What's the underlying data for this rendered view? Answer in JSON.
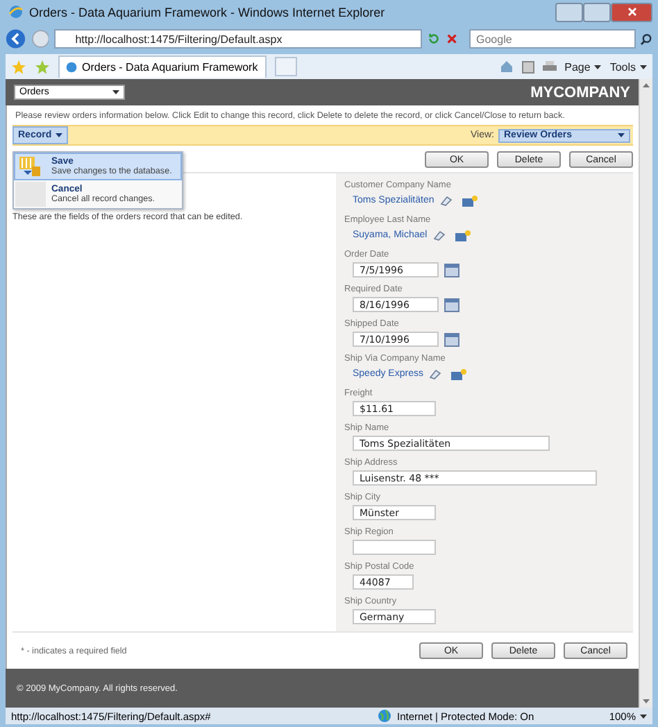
{
  "window": {
    "title": "Orders - Data Aquarium Framework - Windows Internet Explorer"
  },
  "address_bar": {
    "url": "http://localhost:1475/Filtering/Default.aspx"
  },
  "search": {
    "placeholder": "Google"
  },
  "tab": {
    "label": "Orders - Data Aquarium Framework"
  },
  "command_bar": {
    "page": "Page",
    "tools": "Tools"
  },
  "header": {
    "page_select": "Orders",
    "brand": "MYCOMPANY"
  },
  "instructions": "Please review orders information below. Click Edit to change this record, click Delete to delete the record, or click Cancel/Close to return back.",
  "action_bar": {
    "menu": "Record",
    "view_label": "View:",
    "view": "Review Orders"
  },
  "record_menu": [
    {
      "label": "Save",
      "description": "Save changes to the database.",
      "selected": true
    },
    {
      "label": "Cancel",
      "description": "Cancel all record changes.",
      "selected": false
    }
  ],
  "buttons_top": [
    "OK",
    "Delete",
    "Cancel"
  ],
  "description": "These are the fields of the orders record that can be edited.",
  "fields": [
    {
      "label": "Customer Company Name",
      "kind": "lookup",
      "value": "Toms Spezialitäten"
    },
    {
      "label": "Employee Last Name",
      "kind": "lookup",
      "value": "Suyama, Michael"
    },
    {
      "label": "Order Date",
      "kind": "date",
      "value": "7/5/1996"
    },
    {
      "label": "Required Date",
      "kind": "date",
      "value": "8/16/1996"
    },
    {
      "label": "Shipped Date",
      "kind": "date",
      "value": "7/10/1996"
    },
    {
      "label": "Ship Via Company Name",
      "kind": "lookup",
      "value": "Speedy Express"
    },
    {
      "label": "Freight",
      "kind": "text",
      "value": "$11.61"
    },
    {
      "label": "Ship Name",
      "kind": "text",
      "value": "Toms Spezialitäten"
    },
    {
      "label": "Ship Address",
      "kind": "text",
      "value": "Luisenstr. 48 ***"
    },
    {
      "label": "Ship City",
      "kind": "text",
      "value": "Münster"
    },
    {
      "label": "Ship Region",
      "kind": "text"
    },
    {
      "label": "Ship Postal Code",
      "kind": "text",
      "value": "44087"
    },
    {
      "label": "Ship Country",
      "kind": "text",
      "value": "Germany"
    }
  ],
  "required_note": "* - indicates a required field",
  "buttons_bottom": [
    "OK",
    "Delete",
    "Cancel"
  ],
  "footer": "© 2009 MyCompany. All rights reserved.",
  "status_bar": {
    "url": "http://localhost:1475/Filtering/Default.aspx#",
    "zone": "Internet | Protected Mode: On",
    "zoom": "100%"
  }
}
